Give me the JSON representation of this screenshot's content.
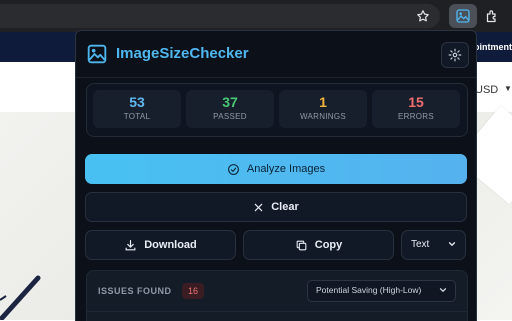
{
  "browser": {
    "icons": [
      "star-icon",
      "image-extension-icon",
      "extensions-puzzle-icon"
    ]
  },
  "site": {
    "nav_text": "ointment",
    "currency": "USD"
  },
  "popup": {
    "title": "ImageSizeChecker",
    "stats": [
      {
        "value": "53",
        "label": "TOTAL",
        "color": "#5fb8f2"
      },
      {
        "value": "37",
        "label": "PASSED",
        "color": "#48c774"
      },
      {
        "value": "1",
        "label": "WARNINGS",
        "color": "#f0b43a"
      },
      {
        "value": "15",
        "label": "ERRORS",
        "color": "#f26d6d"
      }
    ],
    "analyze_label": "Analyze Images",
    "clear_label": "Clear",
    "download_label": "Download",
    "copy_label": "Copy",
    "format": {
      "selected": "Text"
    },
    "issues": {
      "title": "ISSUES FOUND",
      "count": "16",
      "sort": {
        "selected": "Potential Saving (High-Low)"
      }
    }
  },
  "colors": {
    "accent": "#4fb7f0",
    "popup_bg": "#0c1119",
    "primary_button": "#48c1f2"
  }
}
